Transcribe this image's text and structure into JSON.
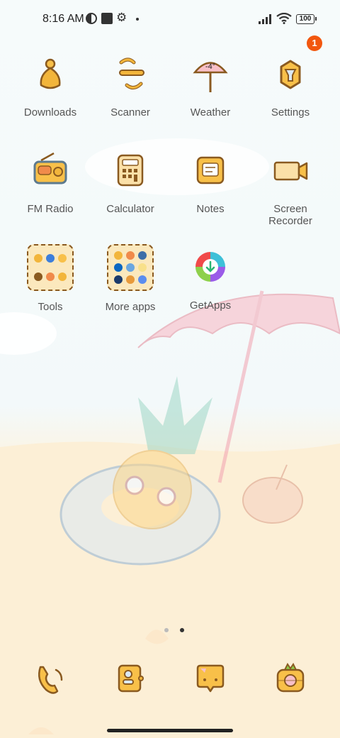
{
  "status_bar": {
    "time": "8:16 AM",
    "battery": "100",
    "icons": [
      "contrast-icon",
      "square-icon",
      "gear-icon",
      "dot-icon",
      "signal-icon",
      "wifi-icon",
      "battery-icon"
    ]
  },
  "apps": [
    {
      "label": "Downloads",
      "icon": "downloads-icon"
    },
    {
      "label": "Scanner",
      "icon": "scanner-icon"
    },
    {
      "label": "Weather",
      "icon": "weather-icon",
      "temp": "-4°"
    },
    {
      "label": "Settings",
      "icon": "settings-icon",
      "badge": "1"
    },
    {
      "label": "FM Radio",
      "icon": "radio-icon"
    },
    {
      "label": "Calculator",
      "icon": "calculator-icon"
    },
    {
      "label": "Notes",
      "icon": "notes-icon"
    },
    {
      "label": "Screen\nRecorder",
      "icon": "screen-recorder-icon"
    },
    {
      "label": "Tools",
      "icon": "tools-folder-icon"
    },
    {
      "label": "More apps",
      "icon": "more-apps-folder-icon"
    },
    {
      "label": "GetApps",
      "icon": "getapps-icon"
    }
  ],
  "dock": [
    {
      "icon": "phone-icon"
    },
    {
      "icon": "contacts-icon"
    },
    {
      "icon": "messages-icon"
    },
    {
      "icon": "camera-icon"
    }
  ],
  "colors": {
    "accent": "#f2b53b",
    "outline": "#8a5a20",
    "badge": "#f2570f"
  }
}
